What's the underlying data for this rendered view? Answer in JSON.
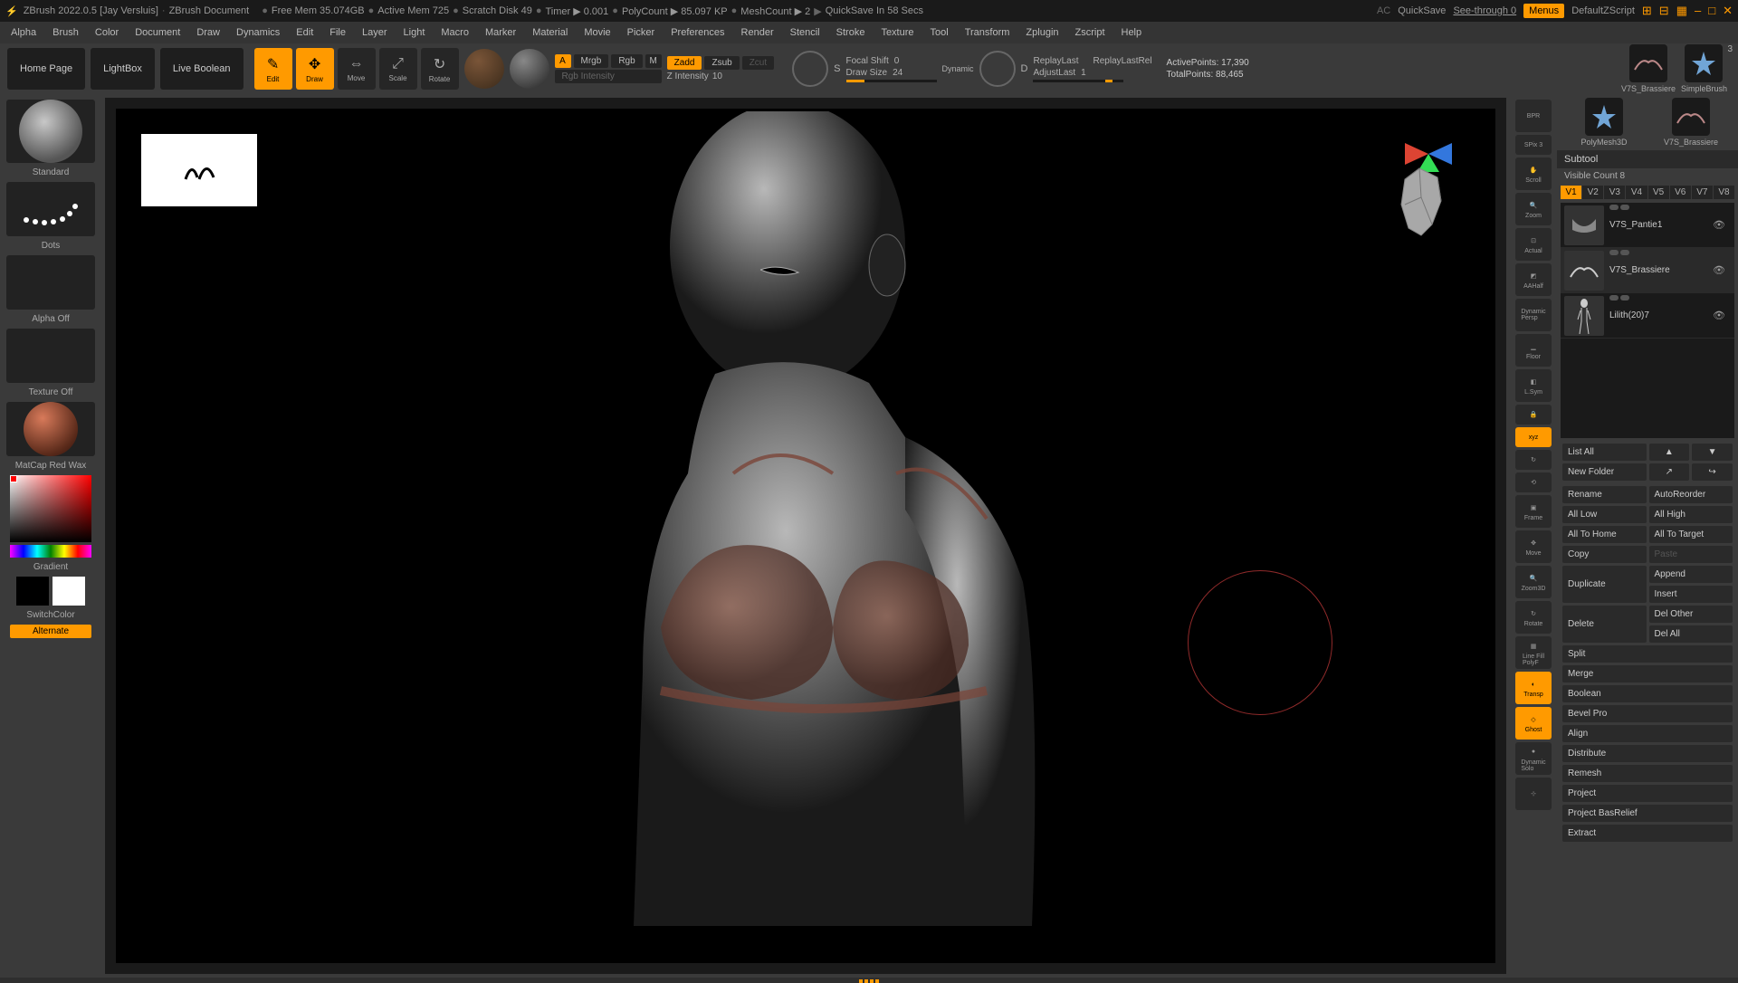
{
  "title_bar": {
    "app": "ZBrush 2022.0.5 [Jay Versluis]",
    "doc": "ZBrush Document",
    "free_mem": "Free Mem 35.074GB",
    "active_mem": "Active Mem 725",
    "scratch": "Scratch Disk 49",
    "timer": "Timer ▶ 0.001",
    "poly": "PolyCount ▶ 85.097 KP",
    "mesh": "MeshCount ▶ 2",
    "quicksave": "QuickSave In 58 Secs",
    "ac": "AC",
    "quicksave_btn": "QuickSave",
    "seethrough": "See-through  0",
    "menus": "Menus",
    "defaultzs": "DefaultZScript"
  },
  "menu": [
    "Alpha",
    "Brush",
    "Color",
    "Document",
    "Draw",
    "Dynamics",
    "Edit",
    "File",
    "Layer",
    "Light",
    "Macro",
    "Marker",
    "Material",
    "Movie",
    "Picker",
    "Preferences",
    "Render",
    "Stencil",
    "Stroke",
    "Texture",
    "Tool",
    "Transform",
    "Zplugin",
    "Zscript",
    "Help"
  ],
  "shelf": {
    "home": "Home Page",
    "lightbox": "LightBox",
    "liveboolean": "Live Boolean",
    "modes": [
      "Edit",
      "Draw",
      "Move",
      "Scale",
      "Rotate"
    ],
    "a": "A",
    "mrgb": "Mrgb",
    "rgb": "Rgb",
    "m": "M",
    "zadd": "Zadd",
    "zsub": "Zsub",
    "zcut": "Zcut",
    "rgb_int": "Rgb Intensity",
    "zint_lbl": "Z Intensity",
    "zint_val": "10",
    "s_letter": "S",
    "focal_lbl": "Focal Shift",
    "focal_val": "0",
    "draw_lbl": "Draw Size",
    "draw_val": "24",
    "dynamic": "Dynamic",
    "d_letter": "D",
    "replay": "ReplayLast",
    "replayrel": "ReplayLastRel",
    "adjust_lbl": "AdjustLast",
    "adjust_val": "1",
    "active_pts": "ActivePoints: 17,390",
    "total_pts": "TotalPoints: 88,465"
  },
  "left": {
    "brush": "Standard",
    "stroke": "Dots",
    "alpha": "Alpha Off",
    "texture": "Texture Off",
    "matcap": "MatCap Red Wax",
    "gradient": "Gradient",
    "switch": "SwitchColor",
    "alternate": "Alternate"
  },
  "vp_btns": {
    "bpr": "BPR",
    "spix_lbl": "SPix",
    "spix_val": "3",
    "scroll": "Scroll",
    "zoom": "Zoom",
    "actual": "Actual",
    "aahalf": "AAHalf",
    "dynamic": "Dynamic",
    "persp": "Persp",
    "floor": "Floor",
    "lsym": "L.Sym",
    "xyz": "xyz",
    "frame": "Frame",
    "move": "Move",
    "zoom3d": "Zoom3D",
    "rotate": "Rotate",
    "linefill": "Line Fill",
    "polyf": "PolyF",
    "transp": "Transp",
    "ghost": "Ghost",
    "dyn2": "Dynamic",
    "solo": "Solo"
  },
  "tools": {
    "left": {
      "name": "V7S_Brassiere"
    },
    "right": {
      "name": "SimpleBrush",
      "badge": "3"
    },
    "below_left": "PolyMesh3D",
    "below_right": "V7S_Brassiere"
  },
  "subtool": {
    "header": "Subtool",
    "visible": "Visible Count 8",
    "views": [
      "V1",
      "V2",
      "V3",
      "V4",
      "V5",
      "V6",
      "V7",
      "V8"
    ],
    "items": [
      {
        "name": "V7S_Pantie1"
      },
      {
        "name": "V7S_Brassiere"
      },
      {
        "name": "Lilith(20)7"
      }
    ],
    "list_all": "List All",
    "new_folder": "New Folder",
    "ops1": [
      "Rename",
      "AutoReorder",
      "All Low",
      "All High",
      "All To Home",
      "All To Target",
      "Copy",
      "Paste"
    ],
    "dup": "Duplicate",
    "append": "Append",
    "insert": "Insert",
    "delete": "Delete",
    "delother": "Del Other",
    "delall": "Del All",
    "rest": [
      "Split",
      "Merge",
      "Boolean",
      "Bevel Pro",
      "Align",
      "Distribute",
      "Remesh",
      "Project",
      "Project BasRelief",
      "Extract"
    ]
  }
}
